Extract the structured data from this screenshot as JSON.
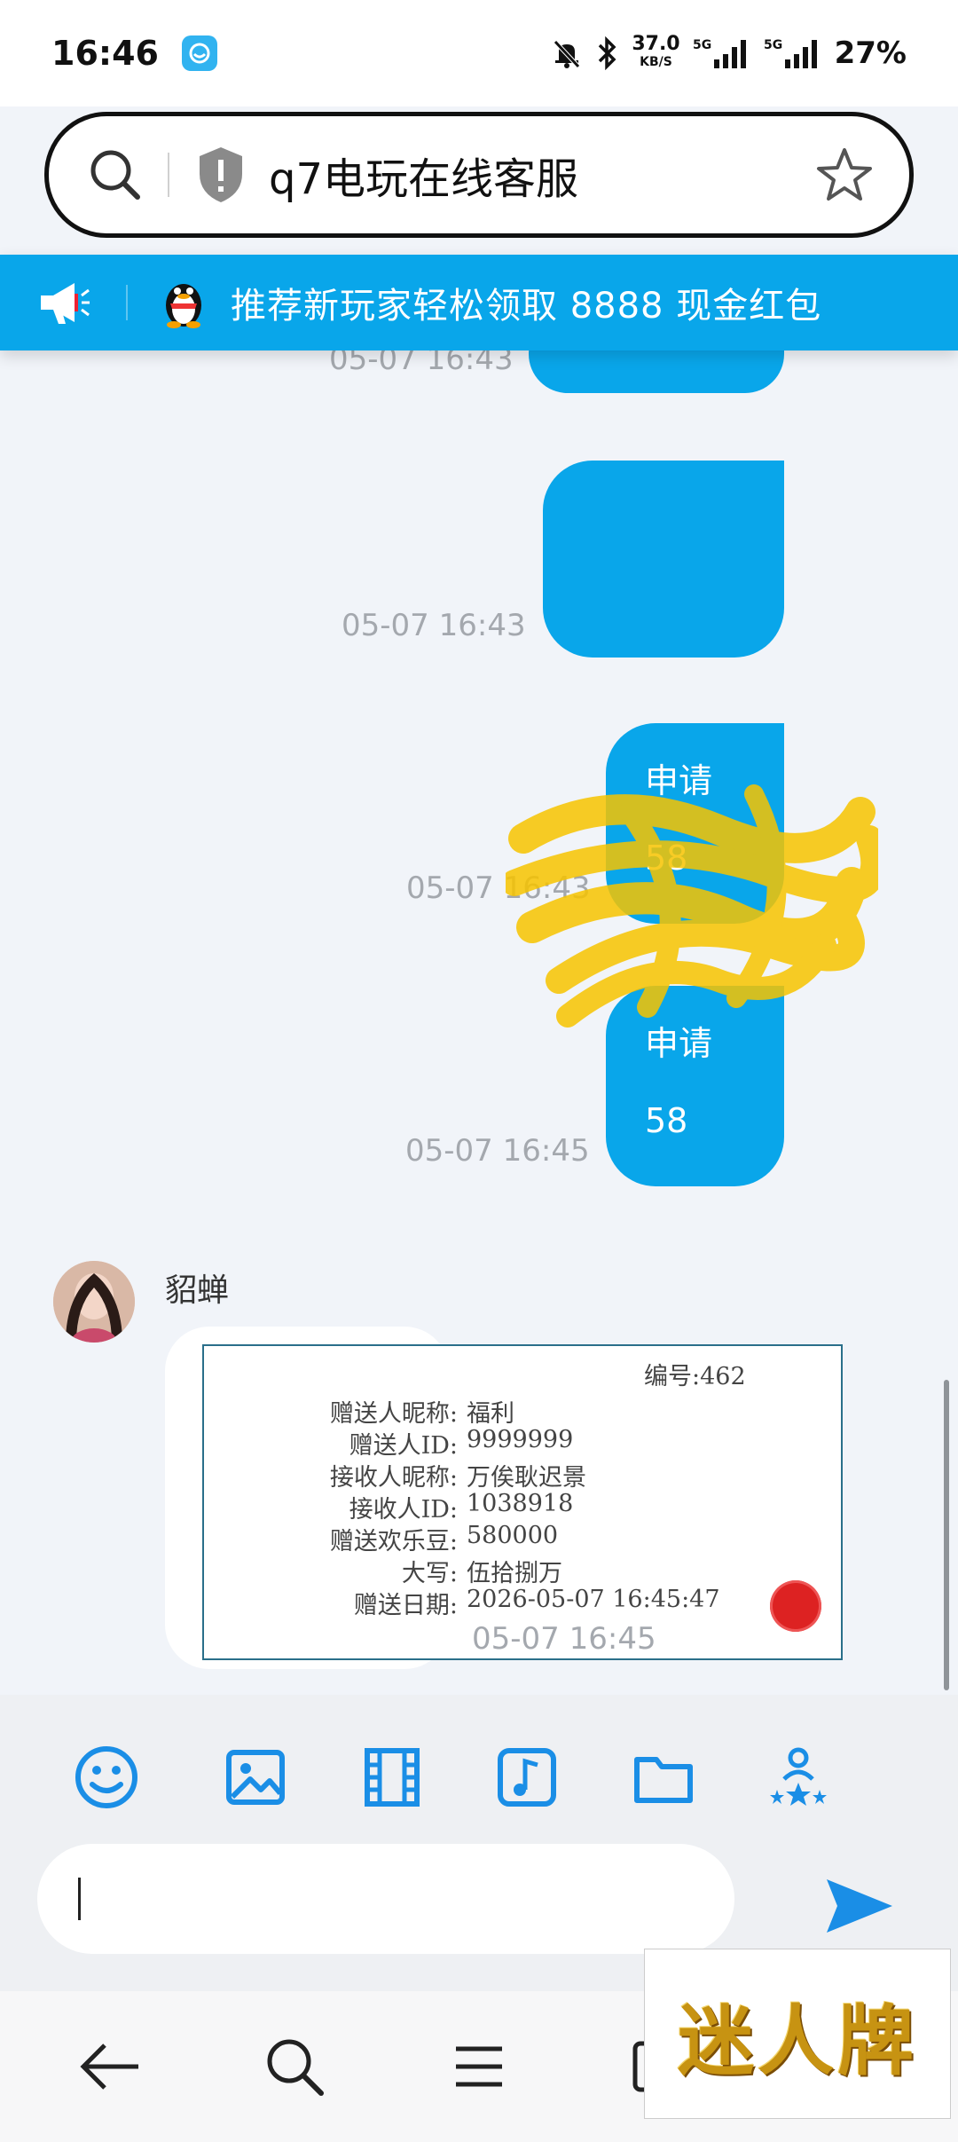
{
  "status_bar": {
    "time": "16:46",
    "net_speed_value": "37.0",
    "net_speed_unit": "KB/S",
    "network_1": "5G",
    "network_2": "5G",
    "battery": "27%"
  },
  "url_bar": {
    "text": "q7电玩在线客服"
  },
  "announcement": {
    "text": "推荐新玩家轻松领取 8888 现金红包"
  },
  "messages": [
    {
      "side": "right",
      "line1": "",
      "line2": "",
      "time": "05-07 16:43"
    },
    {
      "side": "right",
      "line1": "",
      "line2": "",
      "time": "05-07 16:43",
      "obscured": true
    },
    {
      "side": "right",
      "line1": "申请",
      "line2": "58",
      "time": "05-07 16:43"
    },
    {
      "side": "right",
      "line1": "申请",
      "line2": "58",
      "time": "05-07 16:45"
    }
  ],
  "incoming": {
    "sender": "貂蝉",
    "time": "05-07 16:45",
    "certificate": {
      "number_label": "编号:",
      "number_value": "462",
      "rows": [
        {
          "label": "赠送人昵称:",
          "value": "福利"
        },
        {
          "label": "赠送人ID:",
          "value": "9999999"
        },
        {
          "label": "接收人昵称:",
          "value": "万俟耿迟景"
        },
        {
          "label": "接收人ID:",
          "value": "1038918"
        },
        {
          "label": "赠送欢乐豆:",
          "value": "580000"
        },
        {
          "label": "大写:",
          "value": "伍拾捌万"
        },
        {
          "label": "赠送日期:",
          "value": "2026-05-07 16:45:47"
        }
      ]
    }
  },
  "toolbar": {
    "icons": [
      "emoji-icon",
      "image-icon",
      "video-icon",
      "music-icon",
      "folder-icon",
      "rating-icon"
    ],
    "input_value": ""
  },
  "watermark": {
    "text": "迷人牌"
  },
  "colors": {
    "accent": "#09a6ea",
    "background": "#f1f4f9",
    "timestamp": "#a4a8ae"
  }
}
